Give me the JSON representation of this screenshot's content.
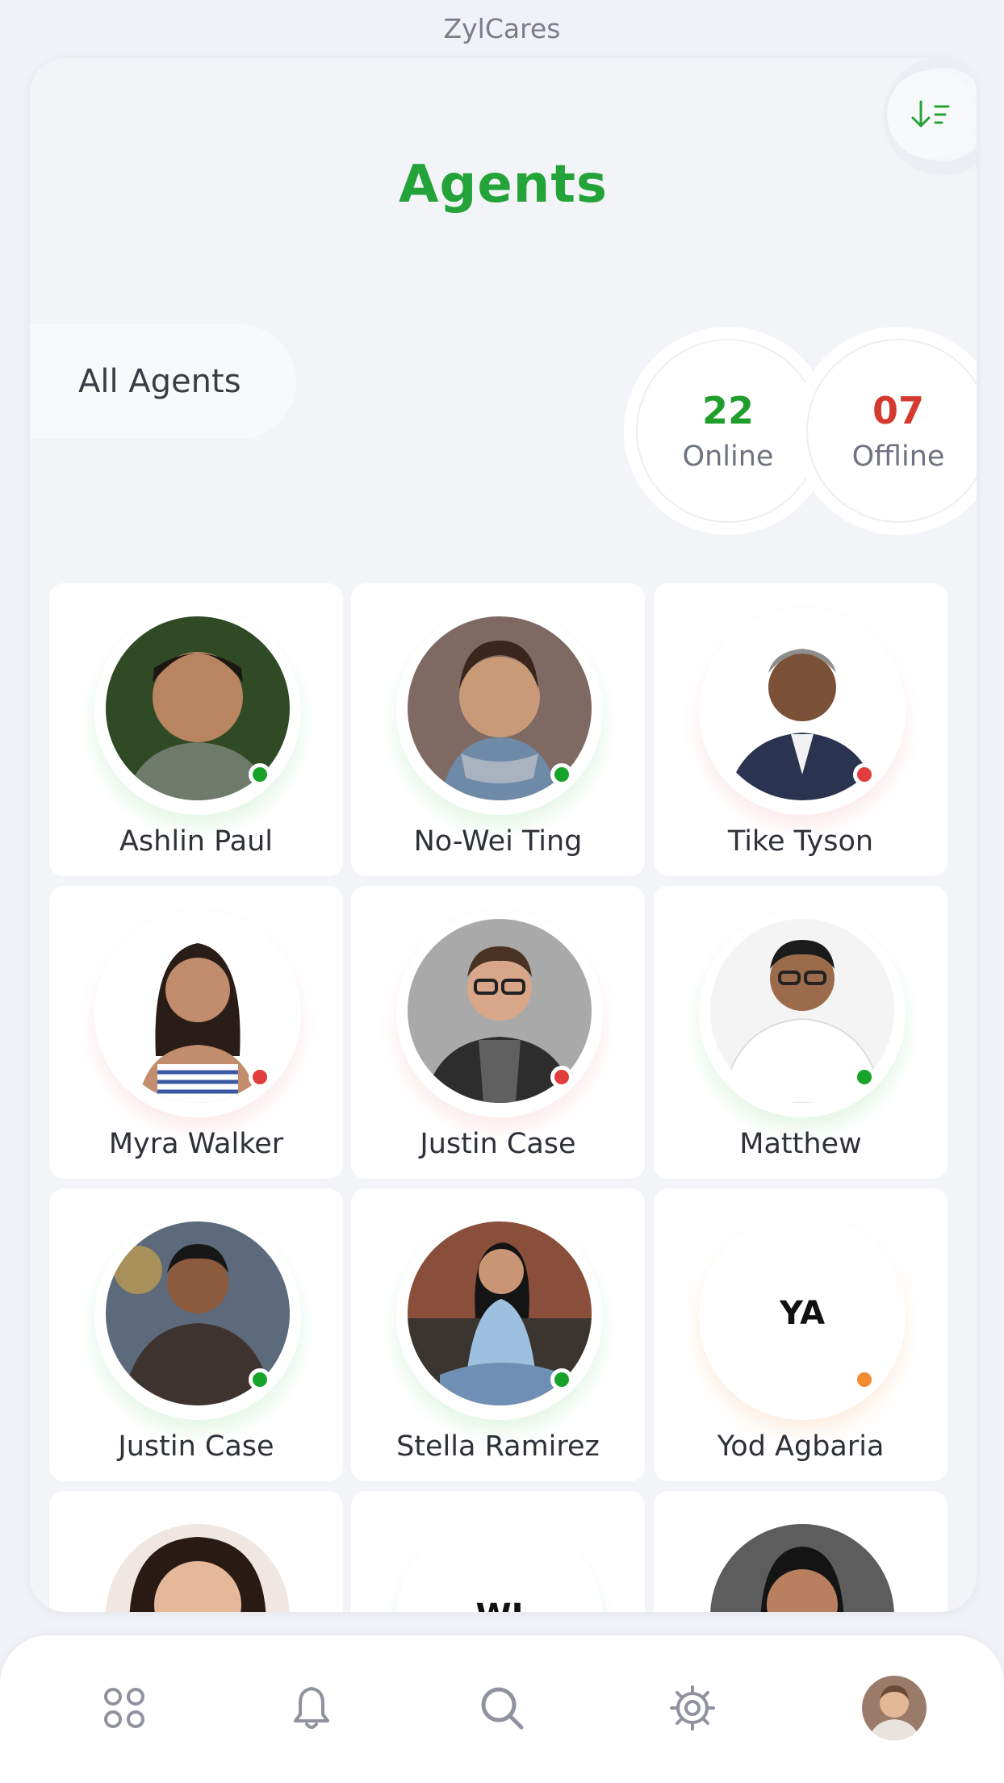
{
  "app": {
    "title": "ZylCares"
  },
  "page": {
    "title": "Agents"
  },
  "filter": {
    "label": "All Agents"
  },
  "counts": {
    "online": {
      "value": "22",
      "label": "Online",
      "color": "#1f9e2c"
    },
    "offline": {
      "value": "07",
      "label": "Offline",
      "color": "#d33b30"
    }
  },
  "status_colors": {
    "online": "#17a32a",
    "offline": "#e23d3d",
    "away": "#f28a2e"
  },
  "agents": [
    {
      "name": "Ashlin Paul",
      "status": "online",
      "initials": ""
    },
    {
      "name": "No-Wei Ting",
      "status": "online",
      "initials": ""
    },
    {
      "name": "Tike Tyson",
      "status": "offline",
      "initials": ""
    },
    {
      "name": "Myra Walker",
      "status": "offline",
      "initials": ""
    },
    {
      "name": "Justin Case",
      "status": "offline",
      "initials": ""
    },
    {
      "name": "Matthew",
      "status": "online",
      "initials": ""
    },
    {
      "name": "Justin Case",
      "status": "online",
      "initials": ""
    },
    {
      "name": "Stella Ramirez",
      "status": "online",
      "initials": ""
    },
    {
      "name": "Yod Agbaria",
      "status": "away",
      "initials": "YA"
    },
    {
      "name": "",
      "status": "",
      "initials": ""
    },
    {
      "name": "",
      "status": "",
      "initials": "WJ"
    },
    {
      "name": "",
      "status": "",
      "initials": ""
    }
  ],
  "nav": {
    "items": [
      "dashboard-icon",
      "bell-icon",
      "search-icon",
      "settings-icon",
      "profile-avatar"
    ]
  }
}
